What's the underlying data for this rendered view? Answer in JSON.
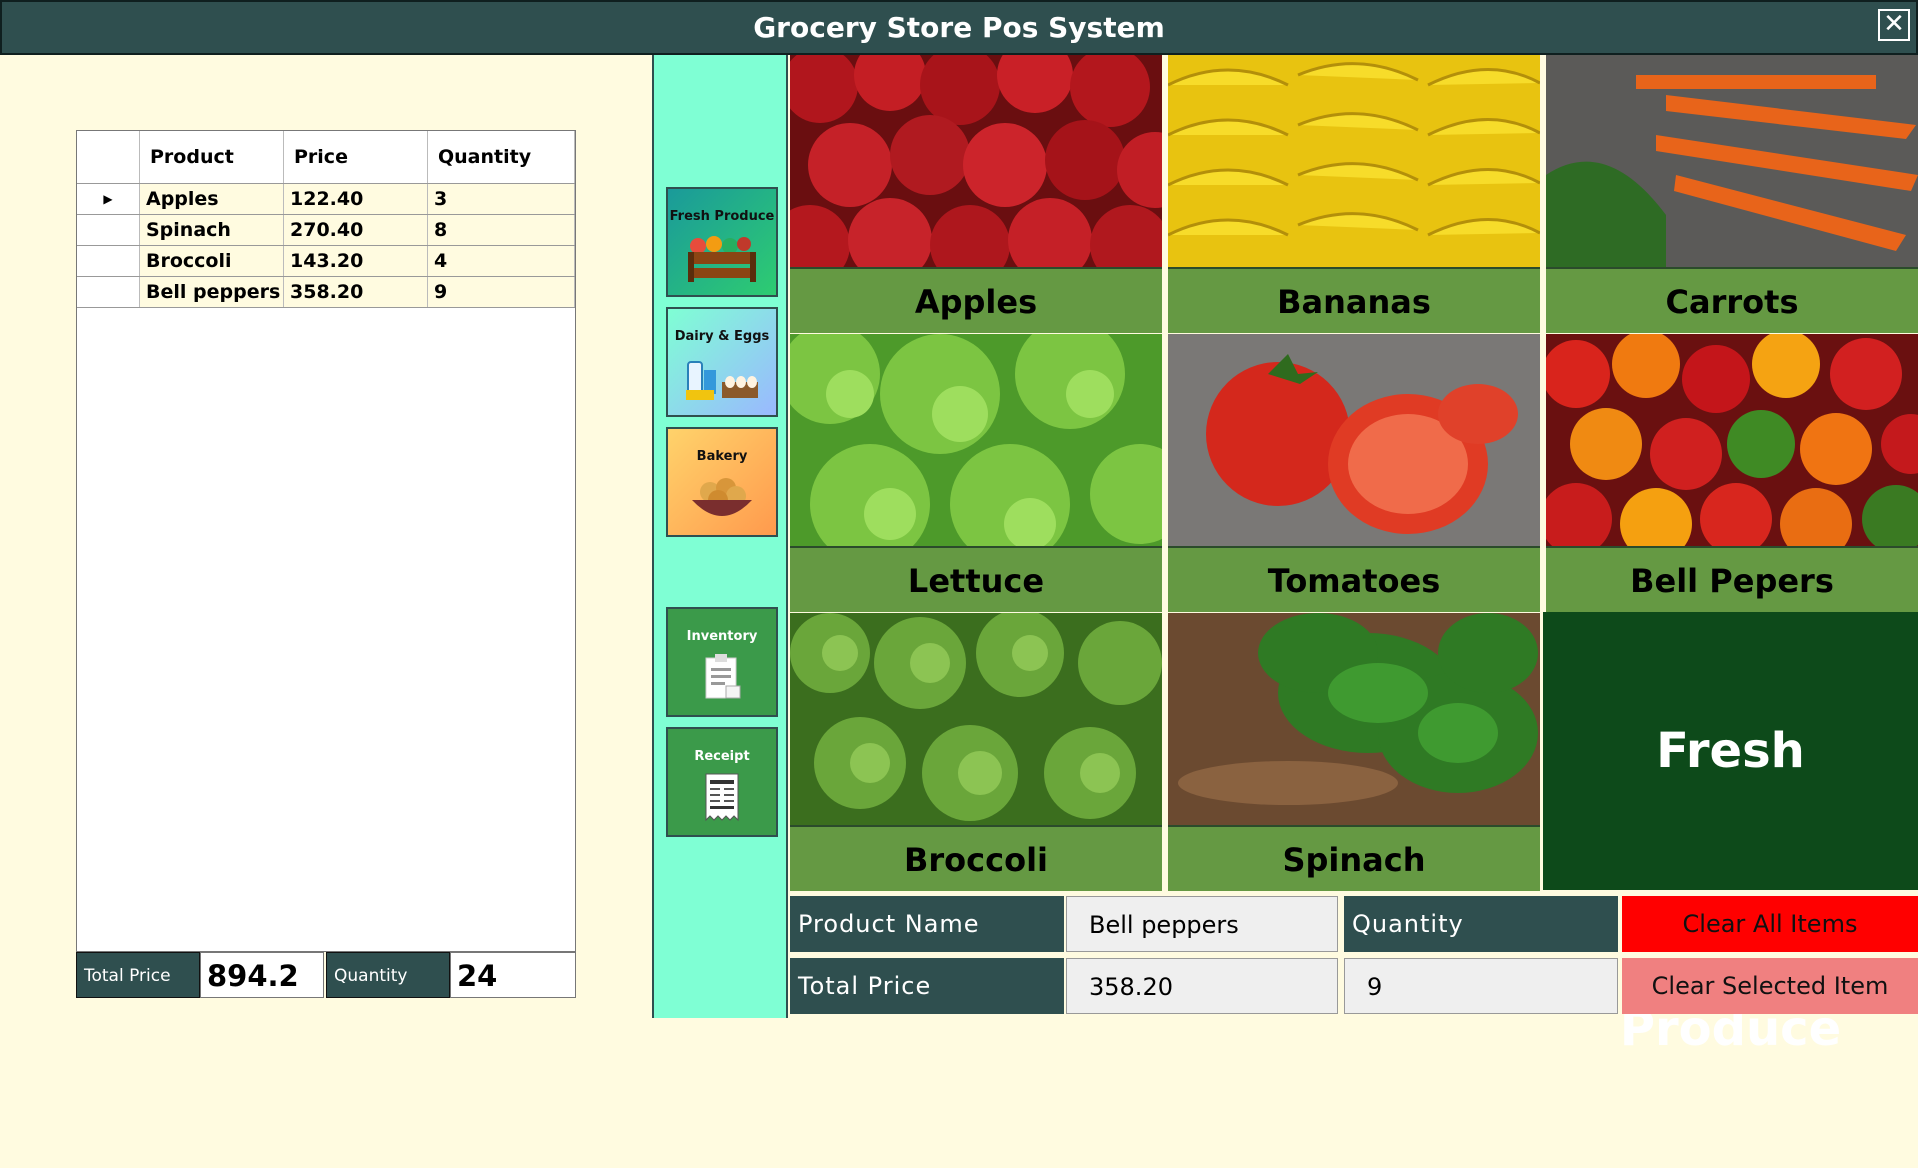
{
  "window": {
    "title": "Grocery Store Pos System",
    "close_icon": "close-icon"
  },
  "cart": {
    "columns": [
      "Product",
      "Price",
      "Quantity"
    ],
    "rows": [
      {
        "product": "Apples",
        "price": "122.40",
        "quantity": "3"
      },
      {
        "product": "Spinach",
        "price": "270.40",
        "quantity": "8"
      },
      {
        "product": "Broccoli",
        "price": "143.20",
        "quantity": "4"
      },
      {
        "product": "Bell peppers",
        "price": "358.20",
        "quantity": "9"
      }
    ],
    "total_price_label": "Total Price",
    "total_price_value": "894.2",
    "quantity_label": "Quantity",
    "quantity_value": "24"
  },
  "categories": [
    {
      "label": "Fresh Produce",
      "icon": "produce-crate-icon"
    },
    {
      "label": "Dairy & Eggs",
      "icon": "dairy-eggs-icon"
    },
    {
      "label": "Bakery",
      "icon": "bread-basket-icon"
    },
    {
      "label": "Inventory",
      "icon": "clipboard-icon"
    },
    {
      "label": "Receipt",
      "icon": "receipt-icon"
    }
  ],
  "products": [
    {
      "name": "Apples"
    },
    {
      "name": "Bananas"
    },
    {
      "name": "Carrots"
    },
    {
      "name": "Lettuce"
    },
    {
      "name": "Tomatoes"
    },
    {
      "name": "Bell Pepers"
    },
    {
      "name": "Broccoli"
    },
    {
      "name": "Spinach"
    }
  ],
  "current_category": "Fresh Produce",
  "form": {
    "product_name_label": "Product Name",
    "product_name_value": "Bell peppers",
    "quantity_label": "Quantity",
    "quantity_value": "9",
    "total_price_label": "Total Price",
    "total_price_value": "358.20",
    "clear_all_label": "Clear All Items",
    "clear_selected_label": "Clear Selected Item"
  },
  "colors": {
    "title_bar": "#2f4f4f",
    "sidebar": "#7fffd4",
    "tile_label": "#659943",
    "banner": "#0d4a1a",
    "clear_all": "#ff0000",
    "clear_selected": "#f08080"
  }
}
